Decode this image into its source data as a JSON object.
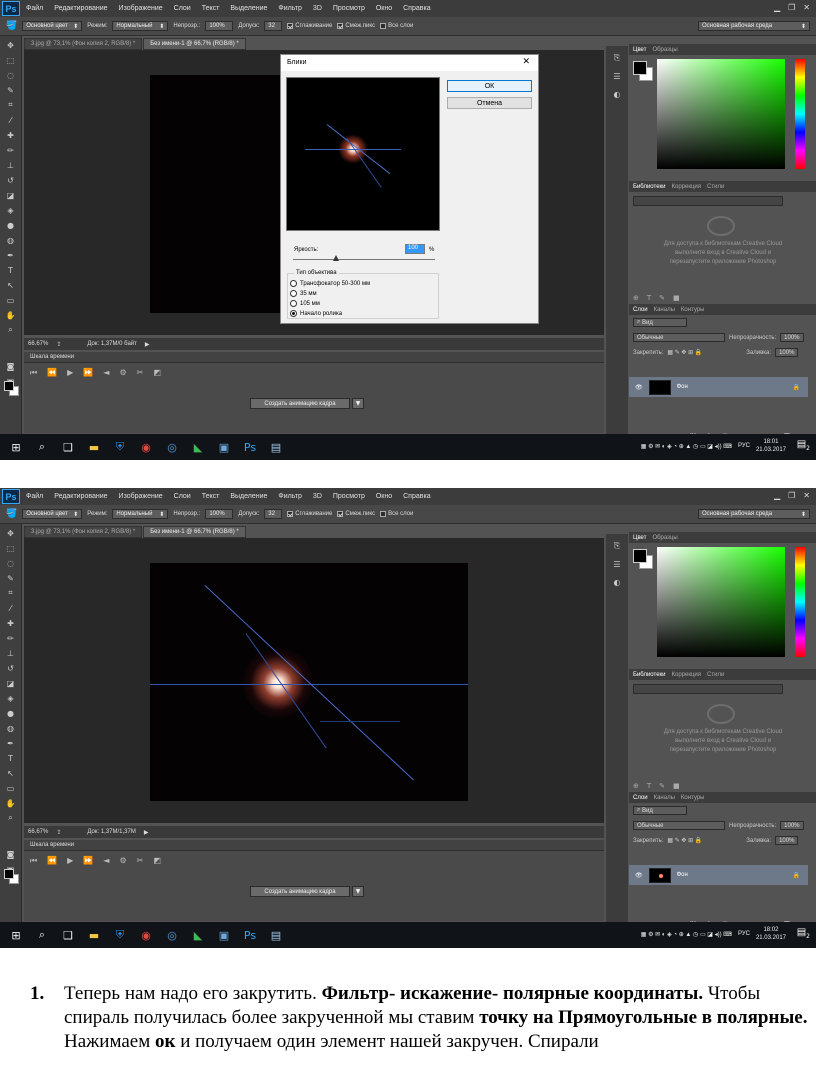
{
  "app": {
    "logo": "Ps",
    "menus": [
      "Файл",
      "Редактирование",
      "Изображение",
      "Слои",
      "Текст",
      "Выделение",
      "Фильтр",
      "3D",
      "Просмотр",
      "Окно",
      "Справка"
    ]
  },
  "options_bar": {
    "color_label": "Основной цвет",
    "mode_label": "Режим:",
    "mode_value": "Нормальный",
    "opacity_label": "Непрозр.:",
    "opacity_value": "100%",
    "tolerance_label": "Допуск:",
    "tolerance_value": "32",
    "antialias": "Сглаживание",
    "contiguous": "Смеж.пикс",
    "all_layers": "Все слои",
    "workspace": "Основная рабочая среда"
  },
  "screens": [
    {
      "tabs": [
        "3.jpg @ 73,1% (Фон копия 2, RGB/8) *",
        "Без имени-1 @ 66,7% (RGB/8) *"
      ],
      "zoom": "66.67%",
      "doc_size": "Док: 1,37М/0 байт",
      "clock_time": "18:01",
      "clock_date": "21.03.2017"
    },
    {
      "tabs": [
        "3.jpg @ 73,1% (Фон копия 2, RGB/8) *",
        "Без имени-1 @ 66,7% (RGB/8) *"
      ],
      "zoom": "66.67%",
      "doc_size": "Док: 1,37М/1,37М",
      "clock_time": "18:02",
      "clock_date": "21.03.2017"
    }
  ],
  "timeline": {
    "title": "Шкала времени",
    "create_button": "Создать анимацию кадра"
  },
  "panels": {
    "color_tabs": [
      "Цвет",
      "Образцы"
    ],
    "lib_tabs": [
      "Библиотеки",
      "Коррекция",
      "Стили"
    ],
    "lib_message": "Для доступа к библиотекам Creative Cloud выполните вход в Creative Cloud и перезапустите приложение Photoshop",
    "layers_tabs": [
      "Слои",
      "Каналы",
      "Контуры"
    ],
    "kind_label": "Вид",
    "blend_value": "Обычные",
    "opacity_label": "Непрозрачность:",
    "opacity_value": "100%",
    "lock_label": "Закрепить:",
    "fill_label": "Заливка:",
    "fill_value": "100%",
    "layer_name": "Фон"
  },
  "dialog": {
    "title": "Блики",
    "ok": "ОК",
    "cancel": "Отмена",
    "brightness_label": "Яркость:",
    "brightness_value": "100",
    "brightness_unit": "%",
    "brightness_level": 0.3,
    "lens_group_title": "Тип объектива",
    "lens_options": [
      "Трансфокатор 50-300 мм",
      "35 мм",
      "105 мм",
      "Начало ролика"
    ],
    "lens_selected": 3
  },
  "taskbar": {
    "lang": "РУС",
    "notif_count": "2"
  },
  "caption": {
    "number": "1.",
    "part1": "Теперь нам надо его закрутить. ",
    "bold1": "Фильтр- искажение- полярные координаты.",
    "part2": " Чтобы спираль получилась более закрученной мы ставим ",
    "bold2": "точку на Прямоугольные в полярные.",
    "part3": " Нажимаем ",
    "bold3": "ок",
    "part4": " и получаем один элемент нашей закручен. Спирали"
  },
  "colors": {
    "accent": "#31a8ff",
    "layer_selected": "#6d7889",
    "panel_bg": "#535353"
  }
}
